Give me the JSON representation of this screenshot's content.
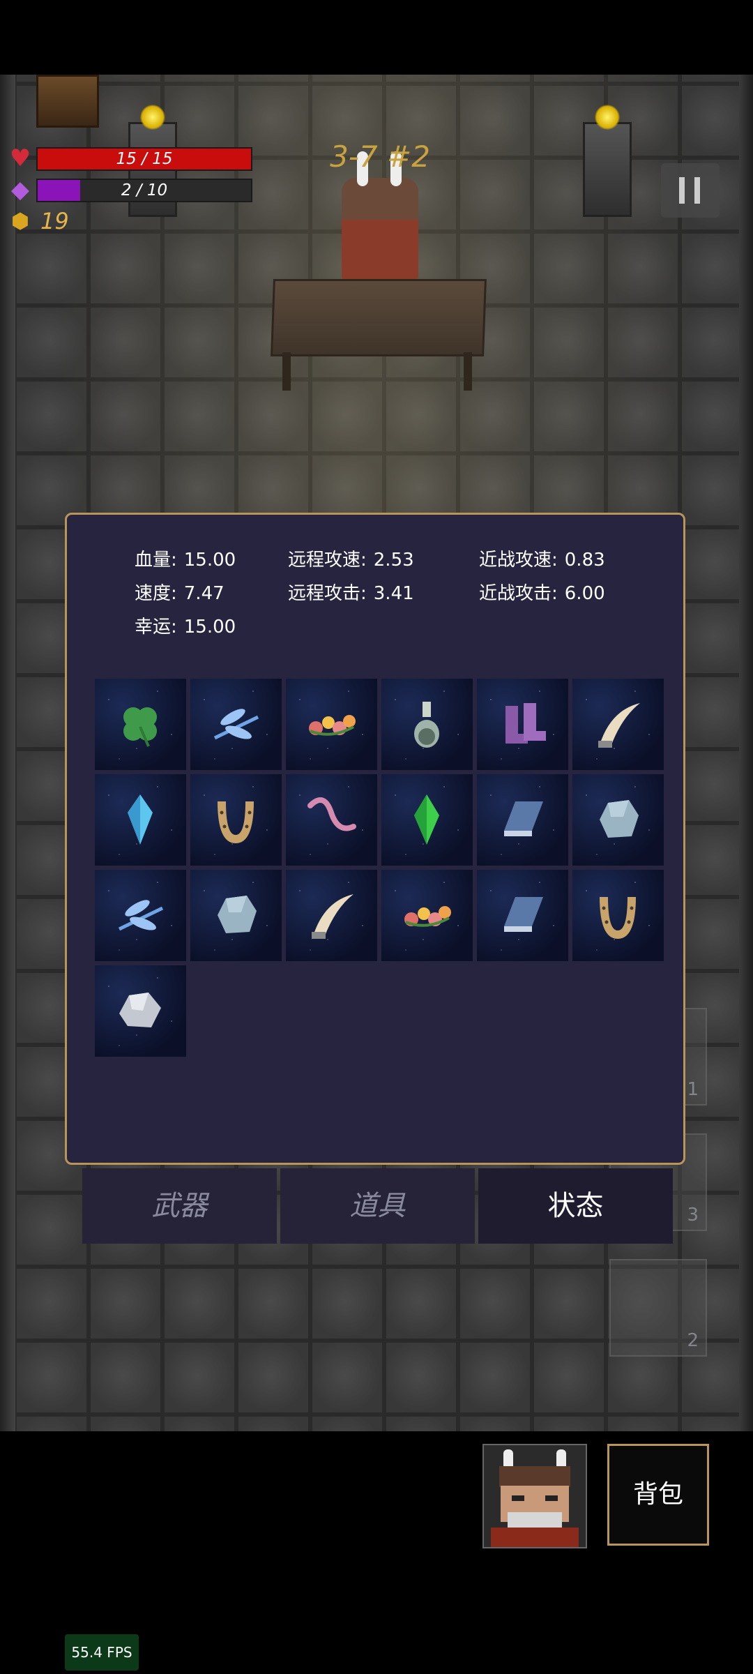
{
  "hud": {
    "hp": {
      "text": "15 / 15",
      "current": 15,
      "max": 15,
      "color": "#c90d0d"
    },
    "mana": {
      "text": "2 / 10",
      "current": 2,
      "max": 10,
      "color": "#8a14b8"
    },
    "gold": "19",
    "level": "3-7 #2"
  },
  "stats": {
    "hp_label": "血量:",
    "hp_value": "15.00",
    "ranged_speed_label": "远程攻速:",
    "ranged_speed_value": "2.53",
    "melee_speed_label": "近战攻速:",
    "melee_speed_value": "0.83",
    "speed_label": "速度:",
    "speed_value": "7.47",
    "ranged_attack_label": "远程攻击:",
    "ranged_attack_value": "3.41",
    "melee_attack_label": "近战攻击:",
    "melee_attack_value": "6.00",
    "luck_label": "幸运:",
    "luck_value": "15.00"
  },
  "items": [
    "four-leaf-clover",
    "dragonfly",
    "flower-garland",
    "potion-bottle",
    "boots",
    "horn",
    "blue-crystal",
    "horseshoe",
    "worm",
    "green-crystal",
    "book",
    "stone",
    "dragonfly",
    "stone",
    "horn",
    "flower-garland",
    "book",
    "horseshoe",
    "silver-ore"
  ],
  "tabs": {
    "weapons": "武器",
    "items": "道具",
    "status": "状态"
  },
  "ghost_counts": [
    "1",
    "3",
    "2"
  ],
  "bag_label": "背包",
  "fps": "55.4 FPS",
  "colors": {
    "panel_border": "#b9955a",
    "panel_bg": "#272440",
    "gold": "#e7b54a"
  }
}
